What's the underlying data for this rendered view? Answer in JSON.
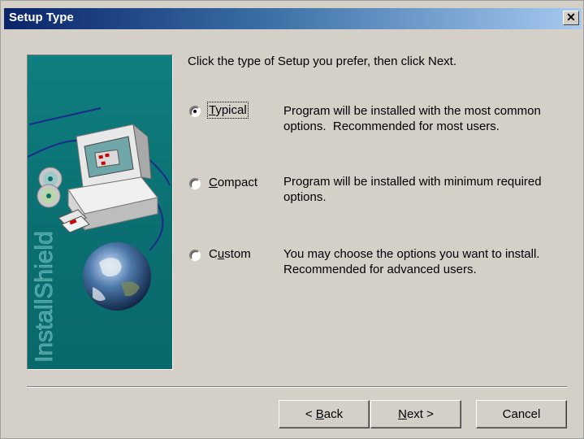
{
  "window": {
    "title": "Setup Type",
    "close_glyph": "✕"
  },
  "banner": {
    "brand": "InstallShield"
  },
  "instruction": "Click the type of Setup you prefer, then click Next.",
  "options": [
    {
      "label_pre": "",
      "label_ul": "T",
      "label_post": "ypical",
      "selected": true,
      "desc_line1": "Program will be installed with the most common",
      "desc_line2": "options.  Recommended for most users."
    },
    {
      "label_pre": "",
      "label_ul": "C",
      "label_post": "ompact",
      "selected": false,
      "desc_line1": "Program will be installed with minimum required",
      "desc_line2": "options."
    },
    {
      "label_pre": "C",
      "label_ul": "u",
      "label_post": "stom",
      "selected": false,
      "desc_line1": "You may choose the options you want to install.",
      "desc_line2": "Recommended for advanced users."
    }
  ],
  "buttons": {
    "back": {
      "pre": "< ",
      "ul": "B",
      "post": "ack"
    },
    "next": {
      "pre": "",
      "ul": "N",
      "post": "ext >"
    },
    "cancel": "Cancel"
  }
}
